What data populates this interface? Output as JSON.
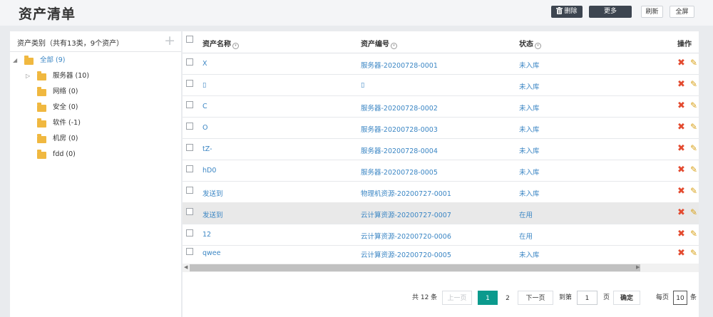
{
  "header": {
    "title": "资产清单",
    "buttons": {
      "delete": "删除",
      "more": "更多",
      "refresh": "刷新",
      "fullscreen": "全屏"
    }
  },
  "sidebar": {
    "title": "资产类别（共有13类，9个资产）",
    "add_glyph": "+",
    "root": {
      "label": "全部 (9)"
    },
    "items": [
      {
        "label": "服务器 (10)"
      },
      {
        "label": "网络 (0)"
      },
      {
        "label": "安全 (0)"
      },
      {
        "label": "软件 (-1)"
      },
      {
        "label": "机房 (0)"
      },
      {
        "label": "fdd (0)"
      }
    ]
  },
  "table": {
    "columns": {
      "name": "资产名称",
      "code": "资产编号",
      "status": "状态",
      "ops": "操作"
    },
    "rows": [
      {
        "name": "X",
        "code": "服务器-20200728-0001",
        "status": "未入库"
      },
      {
        "name": "▯",
        "code": "▯",
        "status": "未入库"
      },
      {
        "name": "C",
        "code": "服务器-20200728-0002",
        "status": "未入库"
      },
      {
        "name": "O",
        "code": "服务器-20200728-0003",
        "status": "未入库"
      },
      {
        "name": "tZ-",
        "code": "服务器-20200728-0004",
        "status": "未入库"
      },
      {
        "name": "hD0",
        "code": "服务器-20200728-0005",
        "status": "未入库"
      },
      {
        "name": "发送到",
        "code": "物理机资源-20200727-0001",
        "status": "未入库"
      },
      {
        "name": "发送到",
        "code": "云计算资源-20200727-0007",
        "status": "在用"
      },
      {
        "name": "12",
        "code": "云计算资源-20200720-0006",
        "status": "在用"
      },
      {
        "name": "qwee",
        "code": "云计算资源-20200720-0005",
        "status": "未入库"
      }
    ]
  },
  "pagination": {
    "total": "共 12 条",
    "prev": "上一页",
    "pages": [
      "1",
      "2"
    ],
    "next": "下一页",
    "goto_label": "到第",
    "goto_value": "1",
    "page_unit": "页",
    "confirm": "确定",
    "per_page_label": "每页",
    "per_page_value": "10",
    "per_page_unit": "条"
  },
  "colors": {
    "accent": "#0b9a8d",
    "link": "#3b86c4",
    "dark_button": "#3d4550",
    "folder": "#f0b840",
    "delete_icon": "#e34a2f",
    "edit_icon": "#d9a21b"
  }
}
